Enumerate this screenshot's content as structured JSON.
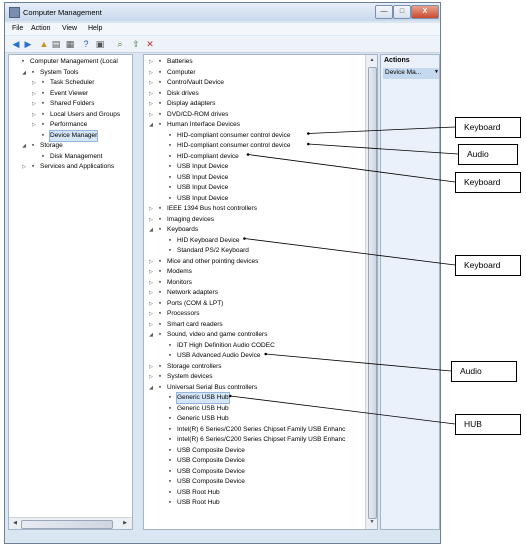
{
  "window": {
    "title": "Computer Management",
    "minimize": "—",
    "maximize": "□",
    "close": "X"
  },
  "menu": [
    "File",
    "Action",
    "View",
    "Help"
  ],
  "toolbar_icons": [
    "back-icon",
    "forward-icon",
    "up-icon",
    "show-hide-tree-icon",
    "properties-icon",
    "help-icon",
    "view-icon",
    "scan-hardware-icon",
    "update-driver-icon",
    "uninstall-icon"
  ],
  "left_tree": [
    {
      "label": "Computer Management (Local",
      "level": 0,
      "expander": "",
      "icon": "computer-icon"
    },
    {
      "label": "System Tools",
      "level": 1,
      "expander": "◢",
      "icon": "tools-icon"
    },
    {
      "label": "Task Scheduler",
      "level": 2,
      "expander": "▷",
      "icon": "clock-icon"
    },
    {
      "label": "Event Viewer",
      "level": 2,
      "expander": "▷",
      "icon": "event-icon"
    },
    {
      "label": "Shared Folders",
      "level": 2,
      "expander": "▷",
      "icon": "folder-icon"
    },
    {
      "label": "Local Users and Groups",
      "level": 2,
      "expander": "▷",
      "icon": "users-icon"
    },
    {
      "label": "Performance",
      "level": 2,
      "expander": "▷",
      "icon": "performance-icon"
    },
    {
      "label": "Device Manager",
      "level": 2,
      "expander": "",
      "icon": "device-manager-icon",
      "selected": true
    },
    {
      "label": "Storage",
      "level": 1,
      "expander": "◢",
      "icon": "storage-icon"
    },
    {
      "label": "Disk Management",
      "level": 2,
      "expander": "",
      "icon": "disk-icon"
    },
    {
      "label": "Services and Applications",
      "level": 1,
      "expander": "▷",
      "icon": "services-icon"
    }
  ],
  "device_tree": [
    {
      "label": "Batteries",
      "level": 0,
      "expander": "▷",
      "icon": "battery-icon"
    },
    {
      "label": "Computer",
      "level": 0,
      "expander": "▷",
      "icon": "computer-icon"
    },
    {
      "label": "ControlVault Device",
      "level": 0,
      "expander": "▷",
      "icon": "device-icon"
    },
    {
      "label": "Disk drives",
      "level": 0,
      "expander": "▷",
      "icon": "disk-icon"
    },
    {
      "label": "Display adapters",
      "level": 0,
      "expander": "▷",
      "icon": "display-icon"
    },
    {
      "label": "DVD/CD-ROM drives",
      "level": 0,
      "expander": "▷",
      "icon": "dvd-icon"
    },
    {
      "label": "Human Interface Devices",
      "level": 0,
      "expander": "◢",
      "icon": "hid-icon"
    },
    {
      "label": "HID-compliant consumer control device",
      "level": 1,
      "expander": "",
      "icon": "hid-icon"
    },
    {
      "label": "HID-compliant consumer control device",
      "level": 1,
      "expander": "",
      "icon": "hid-icon"
    },
    {
      "label": "HID-compliant device",
      "level": 1,
      "expander": "",
      "icon": "hid-icon"
    },
    {
      "label": "USB Input Device",
      "level": 1,
      "expander": "",
      "icon": "hid-icon"
    },
    {
      "label": "USB Input Device",
      "level": 1,
      "expander": "",
      "icon": "hid-icon"
    },
    {
      "label": "USB Input Device",
      "level": 1,
      "expander": "",
      "icon": "hid-icon"
    },
    {
      "label": "USB Input Device",
      "level": 1,
      "expander": "",
      "icon": "hid-icon"
    },
    {
      "label": "IEEE 1394 Bus host controllers",
      "level": 0,
      "expander": "▷",
      "icon": "ieee1394-icon"
    },
    {
      "label": "Imaging devices",
      "level": 0,
      "expander": "▷",
      "icon": "camera-icon"
    },
    {
      "label": "Keyboards",
      "level": 0,
      "expander": "◢",
      "icon": "keyboard-icon"
    },
    {
      "label": "HID Keyboard Device",
      "level": 1,
      "expander": "",
      "icon": "keyboard-icon"
    },
    {
      "label": "Standard PS/2 Keyboard",
      "level": 1,
      "expander": "",
      "icon": "keyboard-icon"
    },
    {
      "label": "Mice and other pointing devices",
      "level": 0,
      "expander": "▷",
      "icon": "mouse-icon"
    },
    {
      "label": "Modems",
      "level": 0,
      "expander": "▷",
      "icon": "modem-icon"
    },
    {
      "label": "Monitors",
      "level": 0,
      "expander": "▷",
      "icon": "monitor-icon"
    },
    {
      "label": "Network adapters",
      "level": 0,
      "expander": "▷",
      "icon": "network-icon"
    },
    {
      "label": "Ports (COM & LPT)",
      "level": 0,
      "expander": "▷",
      "icon": "port-icon"
    },
    {
      "label": "Processors",
      "level": 0,
      "expander": "▷",
      "icon": "processor-icon"
    },
    {
      "label": "Smart card readers",
      "level": 0,
      "expander": "▷",
      "icon": "smartcard-icon"
    },
    {
      "label": "Sound, video and game controllers",
      "level": 0,
      "expander": "◢",
      "icon": "sound-icon"
    },
    {
      "label": "IDT High Definition Audio CODEC",
      "level": 1,
      "expander": "",
      "icon": "sound-icon"
    },
    {
      "label": "USB Advanced Audio Device",
      "level": 1,
      "expander": "",
      "icon": "sound-icon"
    },
    {
      "label": "Storage controllers",
      "level": 0,
      "expander": "▷",
      "icon": "storage-icon"
    },
    {
      "label": "System devices",
      "level": 0,
      "expander": "▷",
      "icon": "system-icon"
    },
    {
      "label": "Universal Serial Bus controllers",
      "level": 0,
      "expander": "◢",
      "icon": "usb-icon"
    },
    {
      "label": "Generic USB Hub",
      "level": 1,
      "expander": "",
      "icon": "usb-icon",
      "selected": true
    },
    {
      "label": "Generic USB Hub",
      "level": 1,
      "expander": "",
      "icon": "usb-icon"
    },
    {
      "label": "Generic USB Hub",
      "level": 1,
      "expander": "",
      "icon": "usb-icon"
    },
    {
      "label": "Intel(R) 6 Series/C200 Series Chipset Family USB Enhanc",
      "level": 1,
      "expander": "",
      "icon": "usb-icon"
    },
    {
      "label": "Intel(R) 6 Series/C200 Series Chipset Family USB Enhanc",
      "level": 1,
      "expander": "",
      "icon": "usb-icon"
    },
    {
      "label": "USB Composite Device",
      "level": 1,
      "expander": "",
      "icon": "usb-icon"
    },
    {
      "label": "USB Composite Device",
      "level": 1,
      "expander": "",
      "icon": "usb-icon"
    },
    {
      "label": "USB Composite Device",
      "level": 1,
      "expander": "",
      "icon": "usb-icon"
    },
    {
      "label": "USB Composite Device",
      "level": 1,
      "expander": "",
      "icon": "usb-icon"
    },
    {
      "label": "USB Root Hub",
      "level": 1,
      "expander": "",
      "icon": "usb-icon"
    },
    {
      "label": "USB Root Hub",
      "level": 1,
      "expander": "",
      "icon": "usb-icon"
    }
  ],
  "actions": {
    "header": "Actions",
    "item": "Device Ma...",
    "item_arrow": "▼"
  },
  "callouts": [
    {
      "label": "Keyboard",
      "target_row": 7
    },
    {
      "label": "Audio",
      "target_row": 8
    },
    {
      "label": "Keyboard",
      "target_row": 9
    },
    {
      "label": "Keyboard",
      "target_row": 17
    },
    {
      "label": "Audio",
      "target_row": 28
    },
    {
      "label": "HUB",
      "target_row": 32
    }
  ]
}
